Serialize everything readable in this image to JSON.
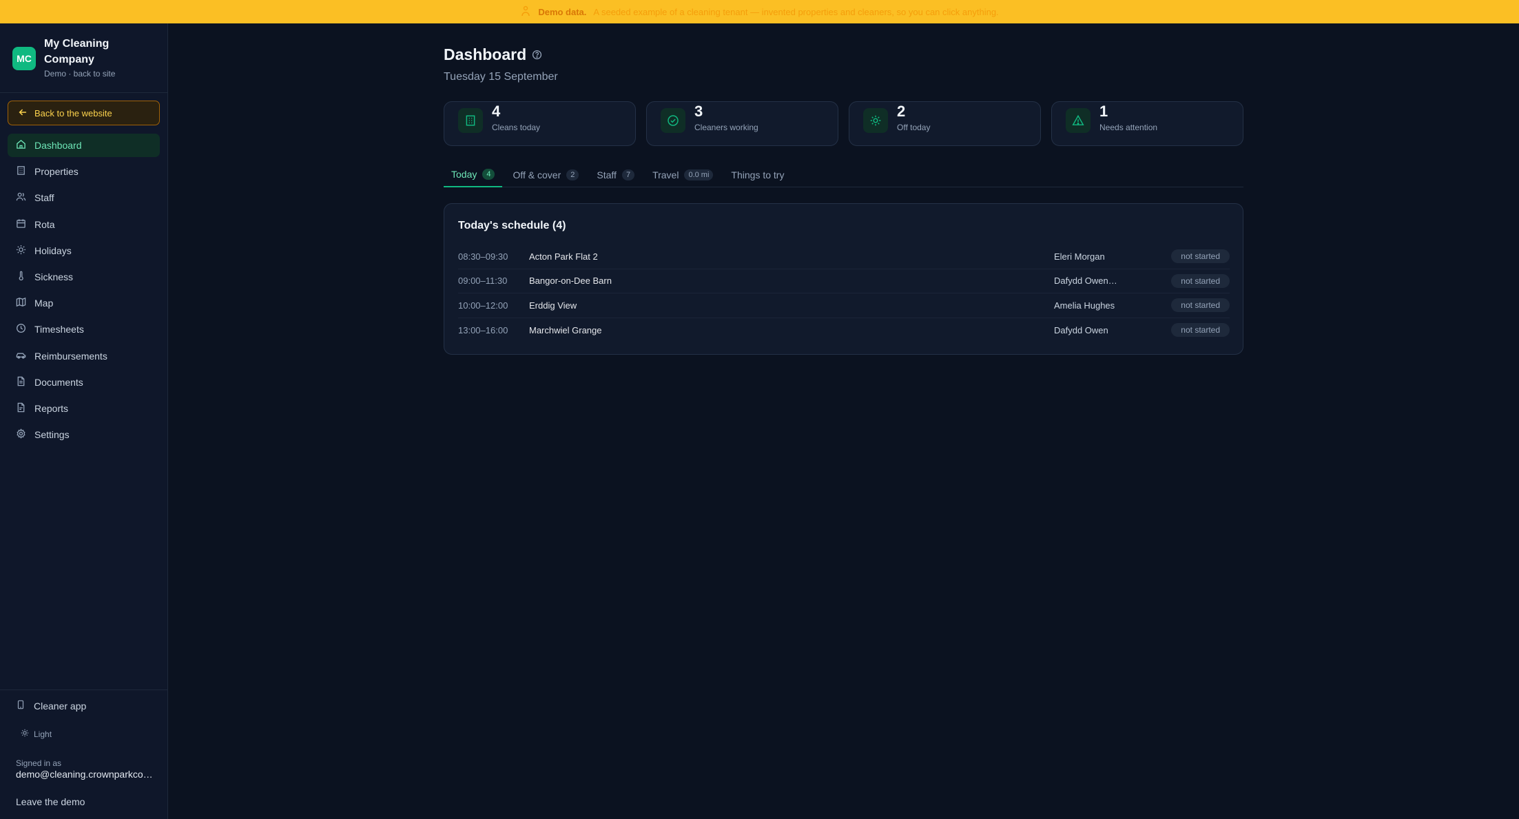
{
  "banner": {
    "strong": "Demo data.",
    "text": "A seeded example of a cleaning tenant — invented properties and cleaners, so you can click anything."
  },
  "brand": {
    "initials": "MC",
    "name": "My Cleaning Company",
    "subtitle": "Demo · back to site"
  },
  "back_button": "Back to the website",
  "nav": [
    {
      "label": "Dashboard",
      "icon": "home-icon",
      "active": true
    },
    {
      "label": "Properties",
      "icon": "building-icon"
    },
    {
      "label": "Staff",
      "icon": "users-icon"
    },
    {
      "label": "Rota",
      "icon": "calendar-icon"
    },
    {
      "label": "Holidays",
      "icon": "sun-icon"
    },
    {
      "label": "Sickness",
      "icon": "thermometer-icon"
    },
    {
      "label": "Map",
      "icon": "map-icon"
    },
    {
      "label": "Timesheets",
      "icon": "clock-icon"
    },
    {
      "label": "Reimbursements",
      "icon": "car-icon"
    },
    {
      "label": "Documents",
      "icon": "file-icon"
    },
    {
      "label": "Reports",
      "icon": "report-icon"
    },
    {
      "label": "Settings",
      "icon": "gear-icon"
    }
  ],
  "sidebar_footer": {
    "cleaner_app": "Cleaner app",
    "theme": "Light",
    "signed_in_label": "Signed in as",
    "signed_in_email": "demo@cleaning.crownparkco…",
    "leave": "Leave the demo"
  },
  "page": {
    "title": "Dashboard",
    "date": "Tuesday 15 September"
  },
  "stats": [
    {
      "value": "4",
      "label": "Cleans today",
      "icon": "building-icon"
    },
    {
      "value": "3",
      "label": "Cleaners working",
      "icon": "check-circle-icon"
    },
    {
      "value": "2",
      "label": "Off today",
      "icon": "sun-icon"
    },
    {
      "value": "1",
      "label": "Needs attention",
      "icon": "warning-icon"
    }
  ],
  "tabs": [
    {
      "label": "Today",
      "count": "4",
      "active": true
    },
    {
      "label": "Off & cover",
      "count": "2"
    },
    {
      "label": "Staff",
      "count": "7"
    },
    {
      "label": "Travel",
      "count": "0.0 mi"
    },
    {
      "label": "Things to try",
      "count": ""
    }
  ],
  "schedule": {
    "title": "Today's schedule (4)",
    "rows": [
      {
        "time": "08:30–09:30",
        "property": "Acton Park Flat 2",
        "cleaner": "Eleri Morgan",
        "status": "not started"
      },
      {
        "time": "09:00–11:30",
        "property": "Bangor-on-Dee Barn",
        "cleaner": "Dafydd Owen…",
        "status": "not started"
      },
      {
        "time": "10:00–12:00",
        "property": "Erddig View",
        "cleaner": "Amelia Hughes",
        "status": "not started"
      },
      {
        "time": "13:00–16:00",
        "property": "Marchwiel Grange",
        "cleaner": "Dafydd Owen",
        "status": "not started"
      }
    ]
  },
  "colors": {
    "accent": "#10b981",
    "banner": "#fbbf24",
    "background": "#0b1220",
    "sidebar": "#0f172a"
  }
}
